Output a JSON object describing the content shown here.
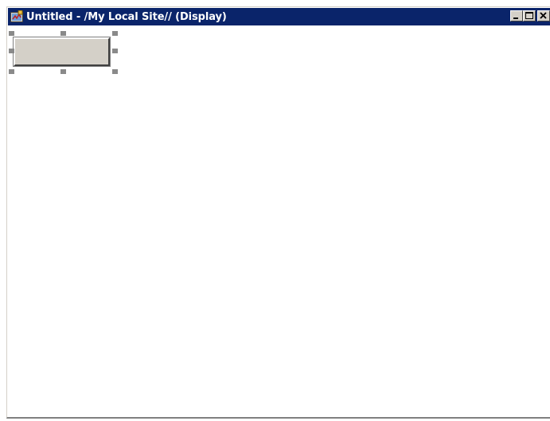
{
  "window": {
    "title": "Untitled - /My Local Site// (Display)",
    "titlebar_color": "#0a246a",
    "icon": "display-app-icon",
    "buttons": {
      "minimize_icon": "minimize-icon",
      "maximize_icon": "maximize-icon",
      "close_icon": "close-icon"
    }
  },
  "canvas": {
    "background": "#ffffff",
    "selected_object": {
      "type": "button-shape",
      "label": "",
      "selected": true,
      "handle_color": "#8a8a8a"
    }
  }
}
